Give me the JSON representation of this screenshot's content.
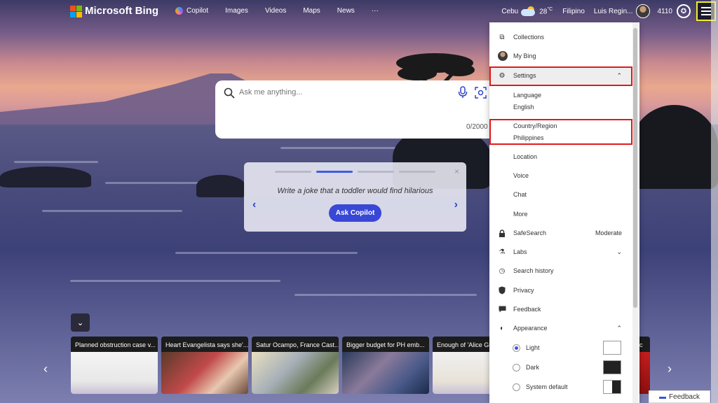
{
  "header": {
    "logo_text": "Microsoft Bing",
    "nav": [
      {
        "label": "Copilot"
      },
      {
        "label": "Images"
      },
      {
        "label": "Videos"
      },
      {
        "label": "Maps"
      },
      {
        "label": "News"
      },
      {
        "label": "···"
      }
    ],
    "location": "Cebu",
    "temperature": "28",
    "temp_unit": "°C",
    "language_link": "Filipino",
    "user_name": "Luis Regin...",
    "points": "4110"
  },
  "search": {
    "placeholder": "Ask me anything...",
    "char_counter": "0/2000"
  },
  "prompt_card": {
    "text": "Write a joke that a toddler would find hilarious",
    "button_label": "Ask Copilot",
    "close": "×",
    "prev": "‹",
    "next": "›"
  },
  "news": [
    {
      "title": "Planned obstruction case v..."
    },
    {
      "title": "Heart Evangelista says she'..."
    },
    {
      "title": "Satur Ocampo, France Cast..."
    },
    {
      "title": "Bigger budget for PH emb..."
    },
    {
      "title": "Enough of 'Alice Gu"
    },
    {
      "title": "ic c"
    }
  ],
  "news_nav": {
    "prev": "‹",
    "next": "›",
    "collapse": "⌄"
  },
  "feedback_label": "Feedback",
  "menu": {
    "collections": "Collections",
    "my_bing": "My Bing",
    "settings": "Settings",
    "language_label": "Language",
    "language_value": "English",
    "country_label": "Country/Region",
    "country_value": "Philippines",
    "location": "Location",
    "voice": "Voice",
    "chat": "Chat",
    "more": "More",
    "safesearch": "SafeSearch",
    "safesearch_value": "Moderate",
    "labs": "Labs",
    "search_history": "Search history",
    "privacy": "Privacy",
    "feedback": "Feedback",
    "appearance": "Appearance",
    "theme_light": "Light",
    "theme_dark": "Dark",
    "theme_system": "System default",
    "selected_theme": "Light"
  },
  "colors": {
    "highlight_red": "#e01b1b",
    "menu_button_outline": "#f3ee27",
    "accent_blue": "#3947d6"
  }
}
